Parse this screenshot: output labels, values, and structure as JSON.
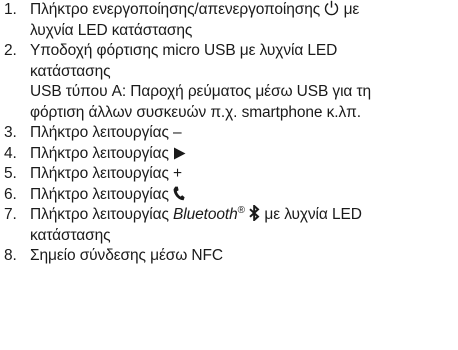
{
  "items": [
    {
      "number": "1.",
      "line1_before_icon": "Πλήκτρο ενεργοποίησης/απενεργοποίησης ",
      "line1_icon": "power-icon",
      "line1_after_icon": " με",
      "line2": "λυχνία LED κατάστασης"
    },
    {
      "number": "2.",
      "line1": "Υποδοχή φόρτισης micro USB με λυχνία LED",
      "line2": "κατάστασης",
      "line3": "USB τύπου A: Παροχή ρεύματος μέσω USB για τη",
      "line4": "φόρτιση άλλων συσκευών π.χ. smartphone κ.λπ."
    },
    {
      "number": "3.",
      "line1": "Πλήκτρο λειτουργίας –"
    },
    {
      "number": "4.",
      "line1": "Πλήκτρο λειτουργίας ",
      "icon": "play-icon"
    },
    {
      "number": "5.",
      "line1": "Πλήκτρο λειτουργίας +"
    },
    {
      "number": "6.",
      "line1": "Πλήκτρο λειτουργίας ",
      "icon": "phone-icon"
    },
    {
      "number": "7.",
      "line1_before": "Πλήκτρο λειτουργίας ",
      "bluetooth_word": "Bluetooth",
      "registered_mark": "®",
      "bluetooth_icon": "bluetooth-icon",
      "line1_after": " με λυχνία LED",
      "line2": "κατάστασης"
    },
    {
      "number": "8.",
      "line1": "Σημείο σύνδεσης μέσω NFC"
    }
  ]
}
